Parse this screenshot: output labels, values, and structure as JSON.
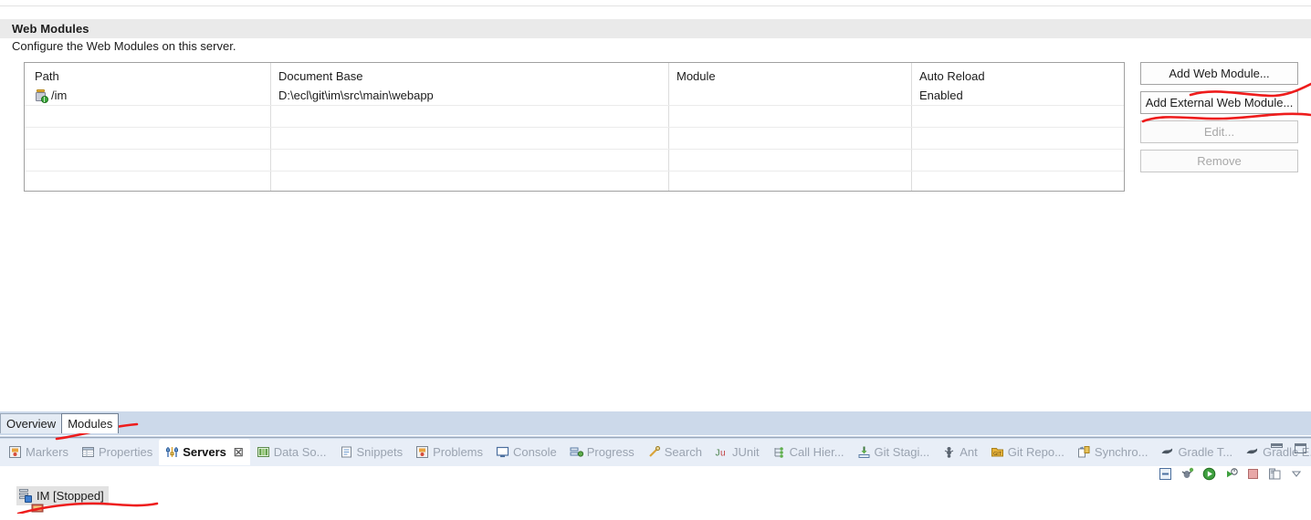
{
  "section": {
    "title": "Web Modules",
    "description": "Configure the Web Modules on this server."
  },
  "table": {
    "columns": [
      "Path",
      "Document Base",
      "Module",
      "Auto Reload"
    ],
    "rows": [
      {
        "icon": "web-module-icon",
        "path": "/im",
        "document_base": "D:\\ecl\\git\\im\\src\\main\\webapp",
        "module": "",
        "auto_reload": "Enabled"
      }
    ],
    "empty_row_count": 4
  },
  "side_buttons": [
    {
      "label": "Add Web Module...",
      "name": "add-web-module-button",
      "disabled": false
    },
    {
      "label": "Add External Web Module...",
      "name": "add-external-web-module-button",
      "disabled": false
    },
    {
      "label": "Edit...",
      "name": "edit-button",
      "disabled": true
    },
    {
      "label": "Remove",
      "name": "remove-button",
      "disabled": true
    }
  ],
  "editor_tabs": [
    {
      "label": "Overview",
      "active": false
    },
    {
      "label": "Modules",
      "active": true
    }
  ],
  "view_tabs": [
    {
      "label": "Markers",
      "icon": "markers-icon",
      "active": false,
      "closable": false
    },
    {
      "label": "Properties",
      "icon": "properties-icon",
      "active": false,
      "closable": false
    },
    {
      "label": "Servers",
      "icon": "servers-icon",
      "active": true,
      "closable": true
    },
    {
      "label": "Data So...",
      "icon": "data-source-icon",
      "active": false,
      "closable": false
    },
    {
      "label": "Snippets",
      "icon": "snippets-icon",
      "active": false,
      "closable": false
    },
    {
      "label": "Problems",
      "icon": "problems-icon",
      "active": false,
      "closable": false
    },
    {
      "label": "Console",
      "icon": "console-icon",
      "active": false,
      "closable": false
    },
    {
      "label": "Progress",
      "icon": "progress-icon",
      "active": false,
      "closable": false
    },
    {
      "label": "Search",
      "icon": "search-icon",
      "active": false,
      "closable": false
    },
    {
      "label": "JUnit",
      "icon": "junit-icon",
      "active": false,
      "closable": false
    },
    {
      "label": "Call Hier...",
      "icon": "call-hierarchy-icon",
      "active": false,
      "closable": false
    },
    {
      "label": "Git Stagi...",
      "icon": "git-staging-icon",
      "active": false,
      "closable": false
    },
    {
      "label": "Ant",
      "icon": "ant-icon",
      "active": false,
      "closable": false
    },
    {
      "label": "Git Repo...",
      "icon": "git-repositories-icon",
      "active": false,
      "closable": false
    },
    {
      "label": "Synchro...",
      "icon": "synchronize-icon",
      "active": false,
      "closable": false
    },
    {
      "label": "Gradle T...",
      "icon": "gradle-tasks-icon",
      "active": false,
      "closable": false
    },
    {
      "label": "Gradle E...",
      "icon": "gradle-executions-icon",
      "active": false,
      "closable": false
    }
  ],
  "view_close_symbol": "☒",
  "servers_toolbar": [
    {
      "name": "collapse-all-icon"
    },
    {
      "name": "debug-icon"
    },
    {
      "name": "start-icon"
    },
    {
      "name": "profile-icon"
    },
    {
      "name": "stop-icon"
    },
    {
      "name": "publish-icon"
    },
    {
      "name": "view-menu-chevron-icon"
    }
  ],
  "servers": [
    {
      "name": "IM",
      "status": "[Stopped]",
      "label": "IM   [Stopped]",
      "selected": true
    }
  ],
  "colors": {
    "section_header_bg": "#eaeaea",
    "tab_bar_bg": "#ccd9ea",
    "view_tab_bg": "#e8eef7",
    "annotation_red": "#ee1c1c",
    "selection_gray": "#e2e2e2"
  }
}
